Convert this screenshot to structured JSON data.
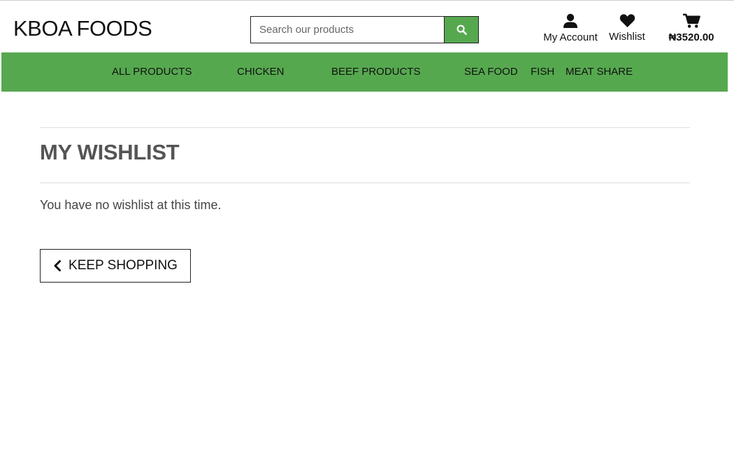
{
  "brand": {
    "name": "KBOA FOODS"
  },
  "search": {
    "placeholder": "Search our products",
    "icon": "search-icon"
  },
  "account": {
    "my_account_label": "My Account",
    "wishlist_label": "Wishlist",
    "cart_total": "₦3520.00"
  },
  "nav": {
    "items": [
      {
        "label": "ALL PRODUCTS"
      },
      {
        "label": "CHICKEN"
      },
      {
        "label": "BEEF PRODUCTS"
      },
      {
        "label": "SEA FOOD"
      },
      {
        "label": "FISH"
      },
      {
        "label": "MEAT SHARE"
      }
    ]
  },
  "main": {
    "title": "MY WISHLIST",
    "empty_message": "You have no wishlist at this time.",
    "keep_shopping_label": "KEEP SHOPPING"
  },
  "colors": {
    "accent": "#56a84f",
    "text": "#111111",
    "muted": "#555555"
  }
}
